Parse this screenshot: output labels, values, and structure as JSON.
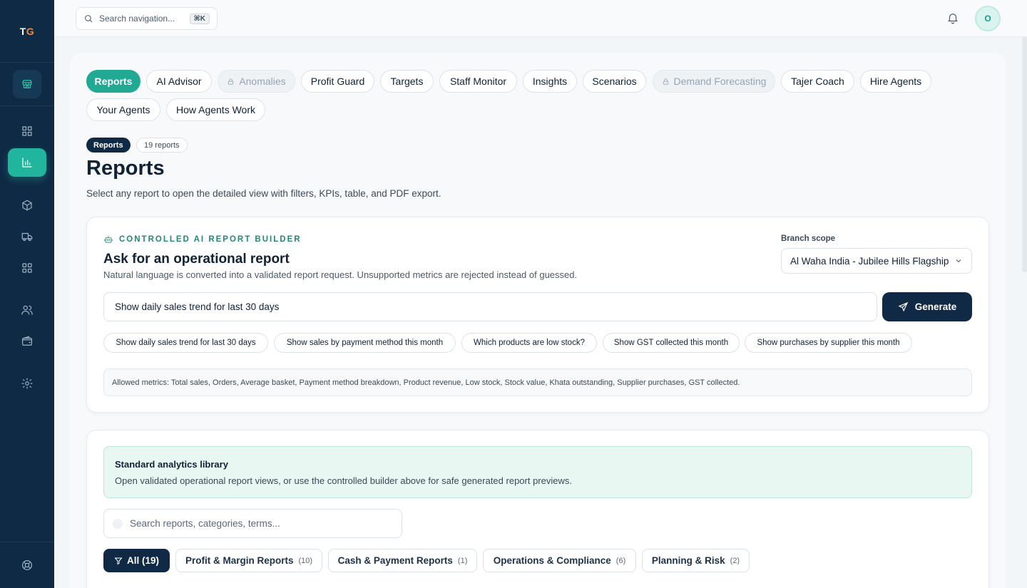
{
  "brand": {
    "logo_t": "T",
    "logo_g": "G"
  },
  "topbar": {
    "search_placeholder": "Search navigation...",
    "shortcut": "⌘K",
    "avatar_initial": "O"
  },
  "tabs": [
    {
      "label": "Reports",
      "state": "active"
    },
    {
      "label": "AI Advisor",
      "state": "normal"
    },
    {
      "label": "Anomalies",
      "state": "locked"
    },
    {
      "label": "Profit Guard",
      "state": "normal"
    },
    {
      "label": "Targets",
      "state": "normal"
    },
    {
      "label": "Staff Monitor",
      "state": "normal"
    },
    {
      "label": "Insights",
      "state": "normal"
    },
    {
      "label": "Scenarios",
      "state": "normal"
    },
    {
      "label": "Demand Forecasting",
      "state": "locked"
    },
    {
      "label": "Tajer Coach",
      "state": "normal"
    },
    {
      "label": "Hire Agents",
      "state": "normal"
    },
    {
      "label": "Your Agents",
      "state": "normal"
    },
    {
      "label": "How Agents Work",
      "state": "normal"
    }
  ],
  "header": {
    "badge": "Reports",
    "count": "19 reports",
    "title": "Reports",
    "subtitle": "Select any report to open the detailed view with filters, KPIs, table, and PDF export."
  },
  "builder": {
    "eyebrow": "CONTROLLED AI REPORT BUILDER",
    "title": "Ask for an operational report",
    "subtitle": "Natural language is converted into a validated report request. Unsupported metrics are rejected instead of guessed.",
    "scope_label": "Branch scope",
    "scope_value": "Al Waha India - Jubilee Hills Flagship",
    "prompt_value": "Show daily sales trend for last 30 days",
    "generate_label": "Generate",
    "suggestions": [
      "Show daily sales trend for last 30 days",
      "Show sales by payment method this month",
      "Which products are low stock?",
      "Show GST collected this month",
      "Show purchases by supplier this month"
    ],
    "allowed_metrics": "Allowed metrics: Total sales, Orders, Average basket, Payment method breakdown, Product revenue, Low stock, Stock value, Khata outstanding, Supplier purchases, GST collected."
  },
  "library": {
    "title": "Standard analytics library",
    "subtitle": "Open validated operational report views, or use the controlled builder above for safe generated report previews.",
    "search_placeholder": "Search reports, categories, terms...",
    "categories": [
      {
        "label": "All (19)",
        "count": "",
        "active": true
      },
      {
        "label": "Profit & Margin Reports",
        "count": "(10)",
        "active": false
      },
      {
        "label": "Cash & Payment Reports",
        "count": "(1)",
        "active": false
      },
      {
        "label": "Operations & Compliance",
        "count": "(6)",
        "active": false
      },
      {
        "label": "Planning & Risk",
        "count": "(2)",
        "active": false
      }
    ]
  },
  "colors": {
    "sidebar": "#0f2a45",
    "accent": "#22a994",
    "dark_button": "#102a45"
  }
}
